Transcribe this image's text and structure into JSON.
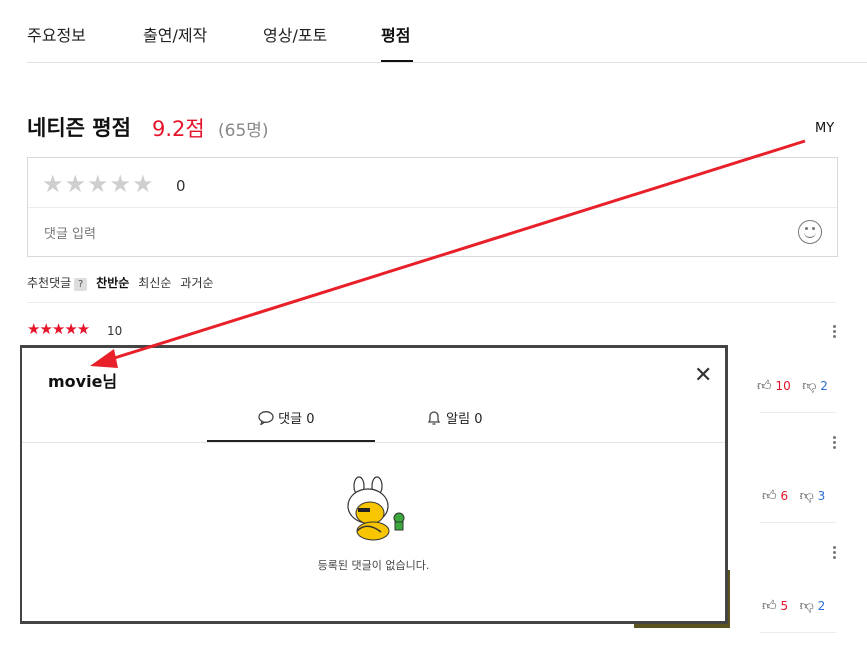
{
  "tabs": [
    {
      "label": "주요정보"
    },
    {
      "label": "출연/제작"
    },
    {
      "label": "영상/포토"
    },
    {
      "label": "평점"
    }
  ],
  "rating": {
    "title": "네티즌 평점",
    "score": "9.2점",
    "count": "(65명)"
  },
  "my_label": "MY",
  "input": {
    "stars": "★★★★★",
    "score": "0",
    "placeholder": "댓글 입력",
    "emoji_icon": "smile-icon"
  },
  "sort": {
    "label": "추천댓글",
    "help": "?",
    "options": [
      "찬반순",
      "최신순",
      "과거순"
    ],
    "active": "찬반순"
  },
  "comment": {
    "stars": "★★★★★",
    "score": "10"
  },
  "votes": [
    {
      "up": "10",
      "down": "2"
    },
    {
      "up": "6",
      "down": "3"
    },
    {
      "up": "5",
      "down": "2"
    }
  ],
  "modal": {
    "title": "movie님",
    "close": "✕",
    "tabs": [
      {
        "label": "댓글 0",
        "icon": "comment-icon"
      },
      {
        "label": "알림 0",
        "icon": "bell-icon"
      }
    ],
    "empty": "등록된 댓글이 없습니다."
  },
  "colors": {
    "accent": "#e5142a",
    "link": "#2b6fd6",
    "arrow": "#e8202a"
  }
}
